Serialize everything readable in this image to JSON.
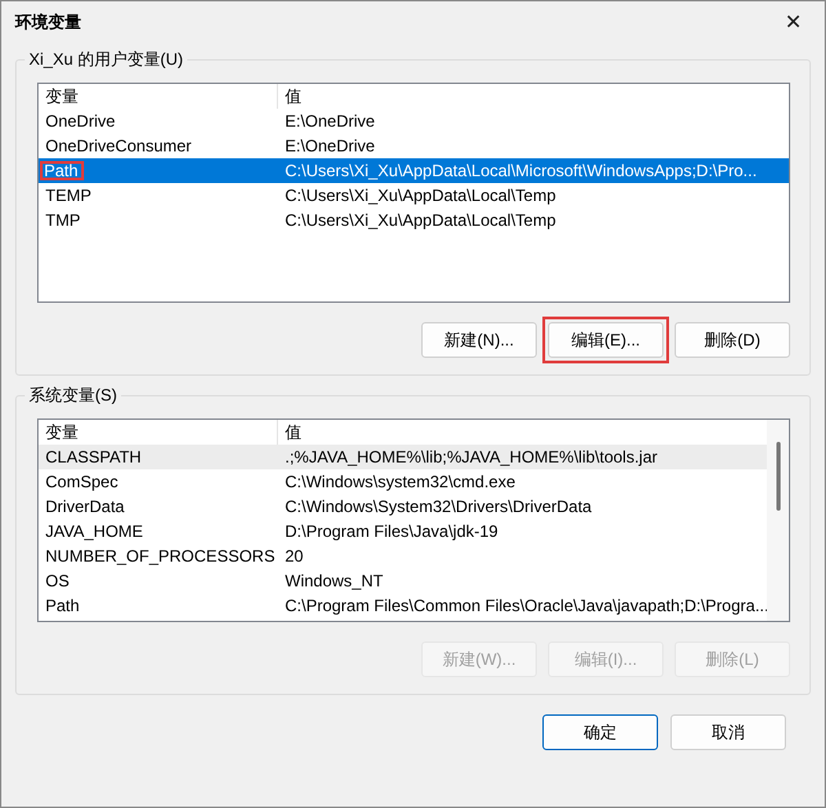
{
  "window": {
    "title": "环境变量",
    "close": "✕"
  },
  "user_vars": {
    "label": "Xi_Xu 的用户变量(U)",
    "columns": [
      "变量",
      "值"
    ],
    "rows": [
      {
        "name": "OneDrive",
        "value": "E:\\OneDrive",
        "selected": false,
        "highlighted": false
      },
      {
        "name": "OneDriveConsumer",
        "value": "E:\\OneDrive",
        "selected": false,
        "highlighted": false
      },
      {
        "name": "Path",
        "value": "C:\\Users\\Xi_Xu\\AppData\\Local\\Microsoft\\WindowsApps;D:\\Pro...",
        "selected": true,
        "highlighted": true
      },
      {
        "name": "TEMP",
        "value": "C:\\Users\\Xi_Xu\\AppData\\Local\\Temp",
        "selected": false,
        "highlighted": false
      },
      {
        "name": "TMP",
        "value": "C:\\Users\\Xi_Xu\\AppData\\Local\\Temp",
        "selected": false,
        "highlighted": false
      }
    ],
    "buttons": [
      {
        "label": "新建(N)...",
        "disabled": false,
        "highlighted": false
      },
      {
        "label": "编辑(E)...",
        "disabled": false,
        "highlighted": true
      },
      {
        "label": "删除(D)",
        "disabled": false,
        "highlighted": false
      }
    ]
  },
  "system_vars": {
    "label": "系统变量(S)",
    "columns": [
      "变量",
      "值"
    ],
    "rows": [
      {
        "name": "CLASSPATH",
        "value": ".;%JAVA_HOME%\\lib;%JAVA_HOME%\\lib\\tools.jar",
        "selected": true,
        "highlighted": false
      },
      {
        "name": "ComSpec",
        "value": "C:\\Windows\\system32\\cmd.exe",
        "selected": false,
        "highlighted": false
      },
      {
        "name": "DriverData",
        "value": "C:\\Windows\\System32\\Drivers\\DriverData",
        "selected": false,
        "highlighted": false
      },
      {
        "name": "JAVA_HOME",
        "value": "D:\\Program Files\\Java\\jdk-19",
        "selected": false,
        "highlighted": false
      },
      {
        "name": "NUMBER_OF_PROCESSORS",
        "value": "20",
        "selected": false,
        "highlighted": false
      },
      {
        "name": "OS",
        "value": "Windows_NT",
        "selected": false,
        "highlighted": false
      },
      {
        "name": "Path",
        "value": "C:\\Program Files\\Common Files\\Oracle\\Java\\javapath;D:\\Progra...",
        "selected": false,
        "highlighted": false
      }
    ],
    "buttons": [
      {
        "label": "新建(W)...",
        "disabled": true,
        "highlighted": false
      },
      {
        "label": "编辑(I)...",
        "disabled": true,
        "highlighted": false
      },
      {
        "label": "删除(L)",
        "disabled": true,
        "highlighted": false
      }
    ]
  },
  "footer_buttons": [
    {
      "label": "确定",
      "default": true
    },
    {
      "label": "取消",
      "default": false
    }
  ]
}
